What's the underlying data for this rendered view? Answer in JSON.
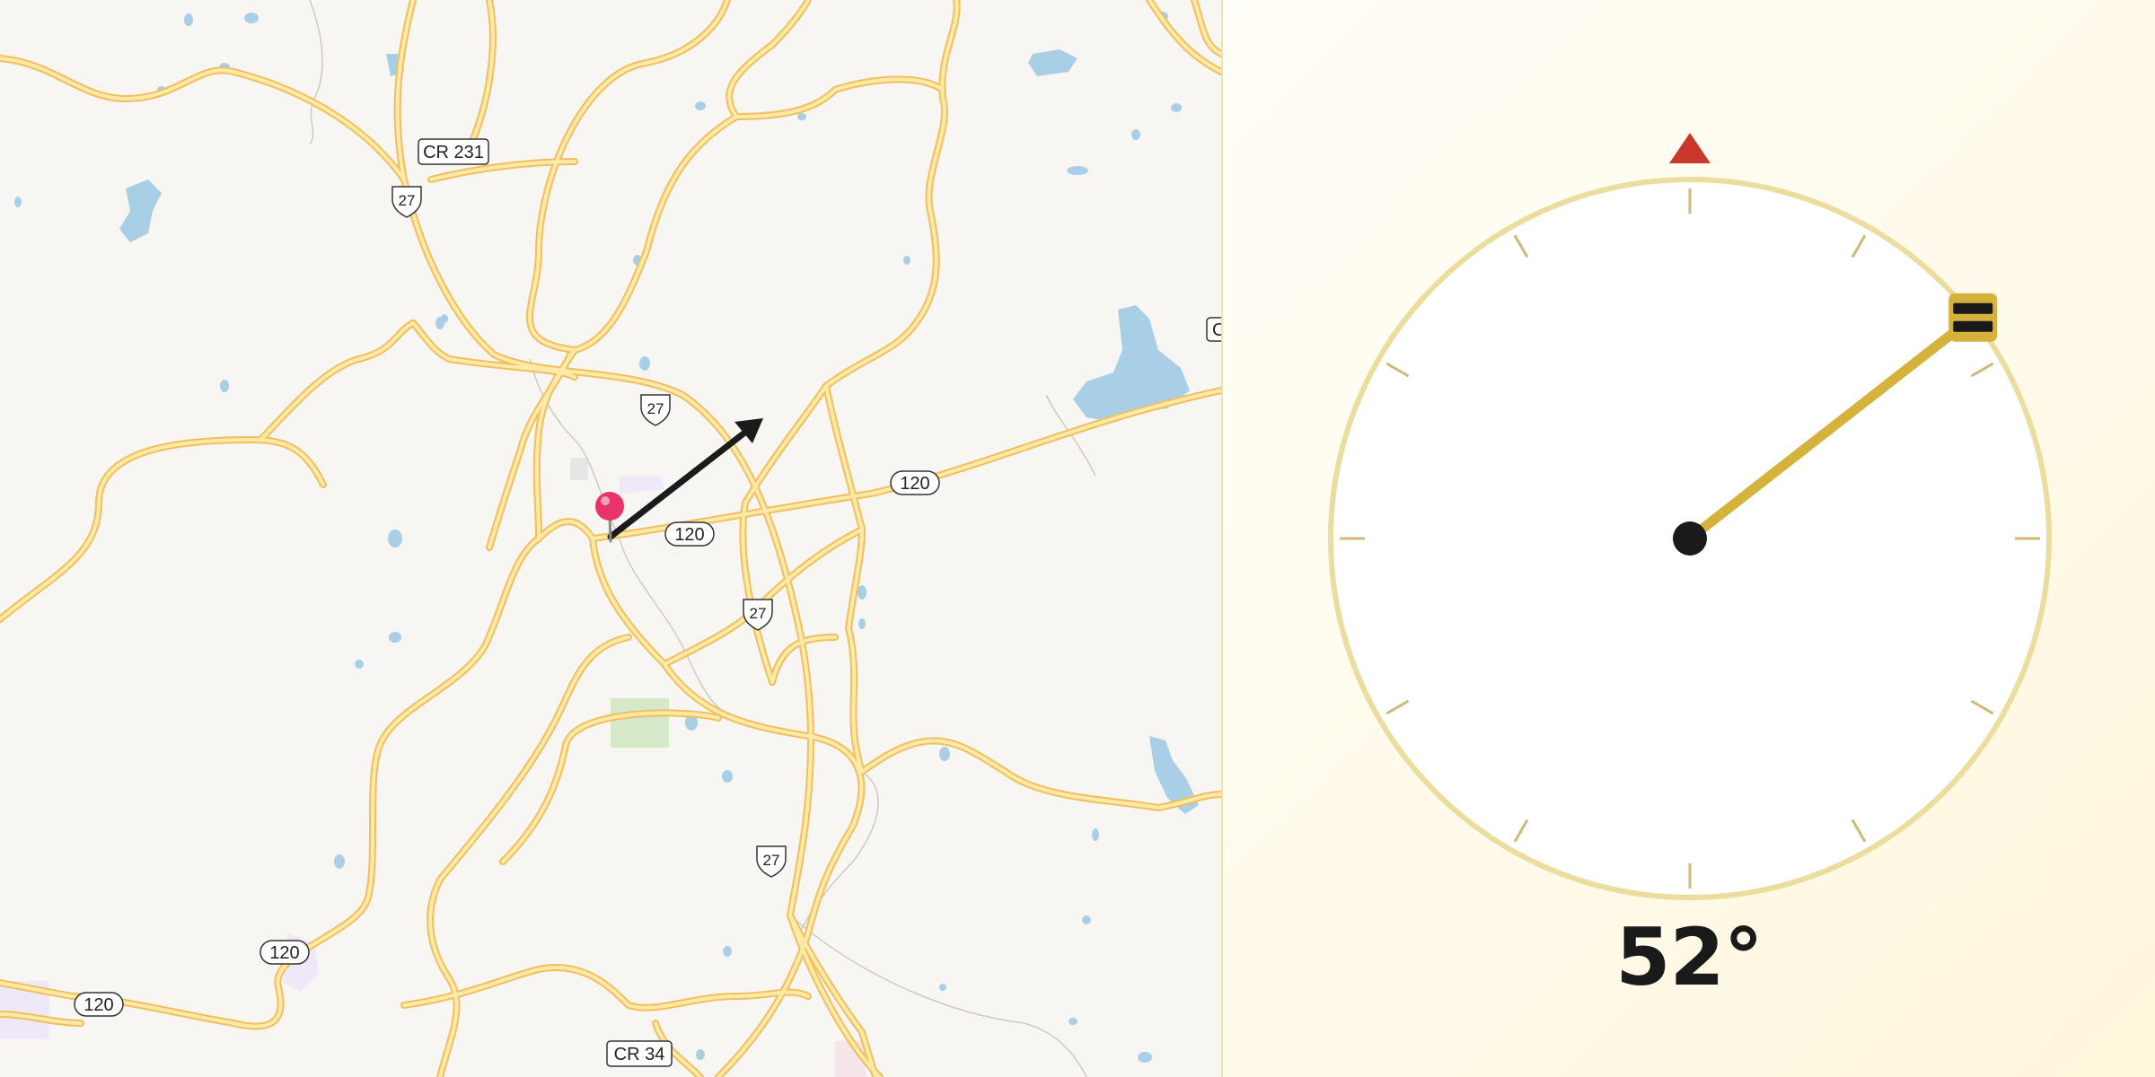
{
  "map": {
    "road_labels": {
      "cr231": "CR 231",
      "us27_a": "27",
      "us27_b": "27",
      "us27_c": "27",
      "us27_d": "27",
      "r120_a": "120",
      "r120_b": "120",
      "r120_c": "120",
      "r120_d": "120",
      "cr34": "CR 34",
      "edge": "C"
    },
    "colors": {
      "road": "#f4c766",
      "road_fill": "#fde9a8",
      "water": "#a9cfe6",
      "park": "#d5e8c7",
      "pin": "#e8336b",
      "arrow": "#1b1b1b"
    },
    "pin_icon": "map-pin-icon",
    "arrow_icon": "heading-arrow-icon"
  },
  "compass": {
    "heading_label": "52°",
    "heading_degrees": 52,
    "north_marker_icon": "north-triangle-icon",
    "handle_icon": "drag-handle-icon",
    "colors": {
      "ring": "#eadd9e",
      "needle": "#d4b23c",
      "north": "#c8392b",
      "ticks": "#cdb97a"
    }
  }
}
